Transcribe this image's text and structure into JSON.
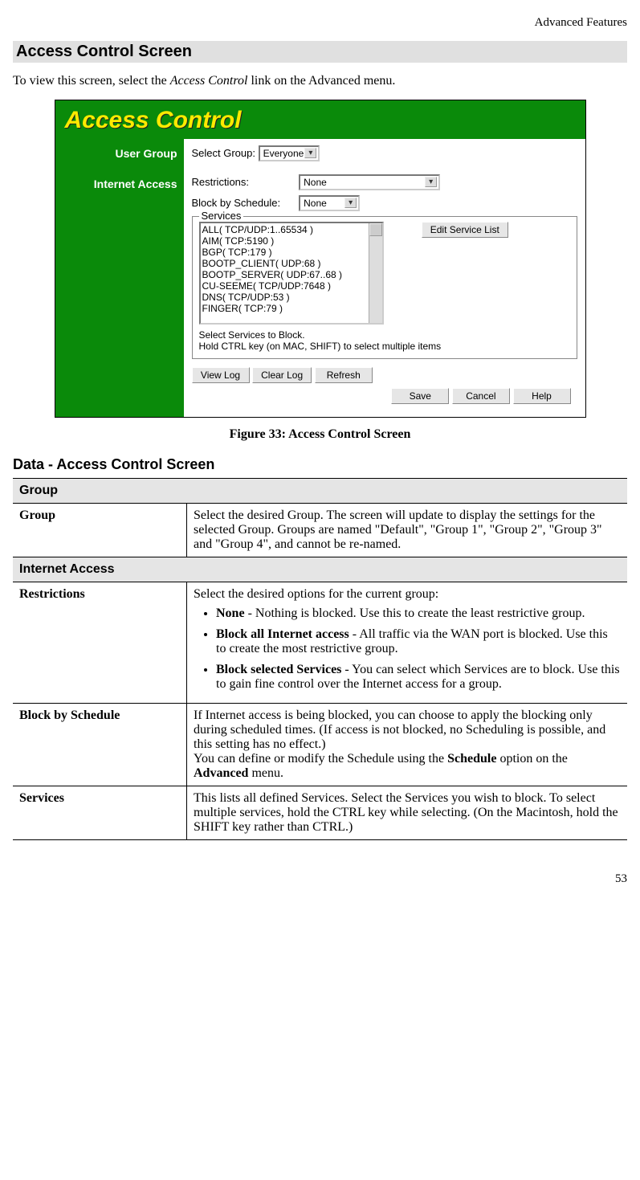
{
  "header": {
    "breadcrumb": "Advanced Features"
  },
  "section_title": "Access Control Screen",
  "intro": {
    "pre": "To view this screen, select the ",
    "link": "Access Control",
    "post": " link on the Advanced menu."
  },
  "figure": {
    "title": "Access Control",
    "side": {
      "user_group": "User Group",
      "internet_access": "Internet Access"
    },
    "select_group_label": "Select Group:",
    "select_group_value": "Everyone",
    "restrictions_label": "Restrictions:",
    "restrictions_value": "None",
    "block_sched_label": "Block by Schedule:",
    "block_sched_value": "None",
    "services_legend": "Services",
    "services": [
      "ALL( TCP/UDP:1..65534 )",
      "AIM( TCP:5190 )",
      "BGP( TCP:179 )",
      "BOOTP_CLIENT( UDP:68 )",
      "BOOTP_SERVER( UDP:67..68 )",
      "CU-SEEME( TCP/UDP:7648 )",
      "DNS( TCP/UDP:53 )",
      "FINGER( TCP:79 )"
    ],
    "edit_service_btn": "Edit Service List",
    "hint1": "Select Services to Block.",
    "hint2": "Hold CTRL key (on MAC, SHIFT) to select multiple items",
    "view_log_btn": "View Log",
    "clear_log_btn": "Clear Log",
    "refresh_btn": "Refresh",
    "save_btn": "Save",
    "cancel_btn": "Cancel",
    "help_btn": "Help"
  },
  "caption": "Figure 33: Access Control Screen",
  "data_heading": "Data - Access Control Screen",
  "table": {
    "sect_group": "Group",
    "row_group_label": "Group",
    "row_group_text": "Select the desired Group. The screen will update to display the settings for the selected Group. Groups are named \"Default\", \"Group 1\", \"Group 2\", \"Group 3\" and \"Group 4\", and cannot be re-named.",
    "sect_internet": "Internet Access",
    "row_restr_label": "Restrictions",
    "row_restr_intro": "Select the desired options for the current group:",
    "row_restr_items": [
      {
        "b": "None",
        "t": " - Nothing is blocked. Use this to create the least restrictive group."
      },
      {
        "b": "Block all Internet access",
        "t": " - All traffic via the WAN port is blocked. Use this to create the most restrictive group."
      },
      {
        "b": "Block selected Services",
        "t": " - You can select which Services are to block. Use this to gain fine control over the Internet access for a group."
      }
    ],
    "row_block_label": "Block by Schedule",
    "row_block_text1": "If Internet access is being blocked, you can choose to apply the blocking only during scheduled times. (If access is not blocked, no Scheduling is possible, and this setting has no effect.)",
    "row_block_text2a": "You can define or modify the Schedule using the ",
    "row_block_b1": "Schedule",
    "row_block_text2b": " option on the ",
    "row_block_b2": "Advanced",
    "row_block_text2c": " menu.",
    "row_svc_label": "Services",
    "row_svc_text": "This lists all defined Services. Select the Services you wish to block. To select multiple services, hold the CTRL key while selecting. (On the Macintosh, hold the SHIFT key rather than CTRL.)"
  },
  "page_number": "53"
}
